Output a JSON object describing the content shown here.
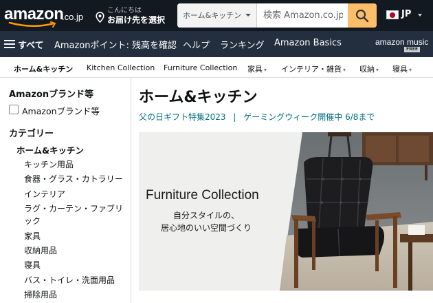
{
  "header": {
    "logo_text": "amazon",
    "logo_cc": ".co.jp",
    "location_line1": "こんにちは",
    "location_line2": "お届け先を選択",
    "search_category": "ホーム&キッチン",
    "search_placeholder": "検索 Amazon.co.jp",
    "language": "JP"
  },
  "nav": {
    "all_label": "すべて",
    "items": [
      "Amazonポイント: 残高を確認",
      "ヘルプ",
      "ランキング",
      "Amazon Basics"
    ],
    "music_label": "amazon music",
    "music_badge": "FREE"
  },
  "subnav": {
    "items": [
      "ホーム&キッチン",
      "Kitchen Collection",
      "Furniture Collection",
      "家具",
      "インテリア・雑貨",
      "収納",
      "寝具"
    ],
    "caret": "▾"
  },
  "sidebar": {
    "brand_heading": "Amazonブランド等",
    "brand_checkbox_label": "Amazonブランド等",
    "category_heading": "カテゴリー",
    "current_category": "ホーム&キッチン",
    "categories": [
      "キッチン用品",
      "食器・グラス・カトラリー",
      "インテリア",
      "ラグ・カーテン・ファブリック",
      "家具",
      "収納用品",
      "寝具",
      "バス・トイレ・洗面用品",
      "掃除用品"
    ]
  },
  "main": {
    "title": "ホーム&キッチン",
    "links": [
      "父の日ギフト特集2023",
      "ゲーミングウィーク開催中 6/8まで"
    ],
    "link_separator": "|",
    "banner": {
      "title": "Furniture Collection",
      "subtitle_line1": "自分スタイルの、",
      "subtitle_line2": "居心地のいい空間づくり"
    }
  },
  "colors": {
    "header_bg": "#131921",
    "nav_bg": "#232f3e",
    "search_button": "#febd69",
    "link": "#007185",
    "logo_smile": "#ff9900"
  },
  "icons": [
    "location-pin-icon",
    "search-icon",
    "hamburger-icon",
    "caret-down-icon",
    "japan-flag-icon",
    "checkbox-icon"
  ]
}
